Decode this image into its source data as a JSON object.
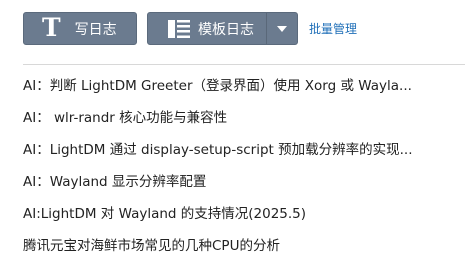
{
  "toolbar": {
    "write_button": {
      "icon": "T",
      "label": "写日志"
    },
    "template_button": {
      "label": "模板日志"
    },
    "manage_link": "批量管理"
  },
  "colors": {
    "button_bg": "#6b7b8f",
    "link": "#1f6fb8",
    "text": "#222222"
  },
  "posts": [
    "AI：判断 LightDM Greeter（登录界面）使用 Xorg 或 Wayla...",
    "AI： wlr-randr 核心功能与兼容性",
    "AI：LightDM 通过 display-setup-script 预加载分辨率的实现...",
    "AI：Wayland 显示分辨率配置",
    "AI:LightDM 对 Wayland 的支持情况(2025.5)",
    "腾讯元宝对海鲜市场常见的几种CPU的分析"
  ]
}
